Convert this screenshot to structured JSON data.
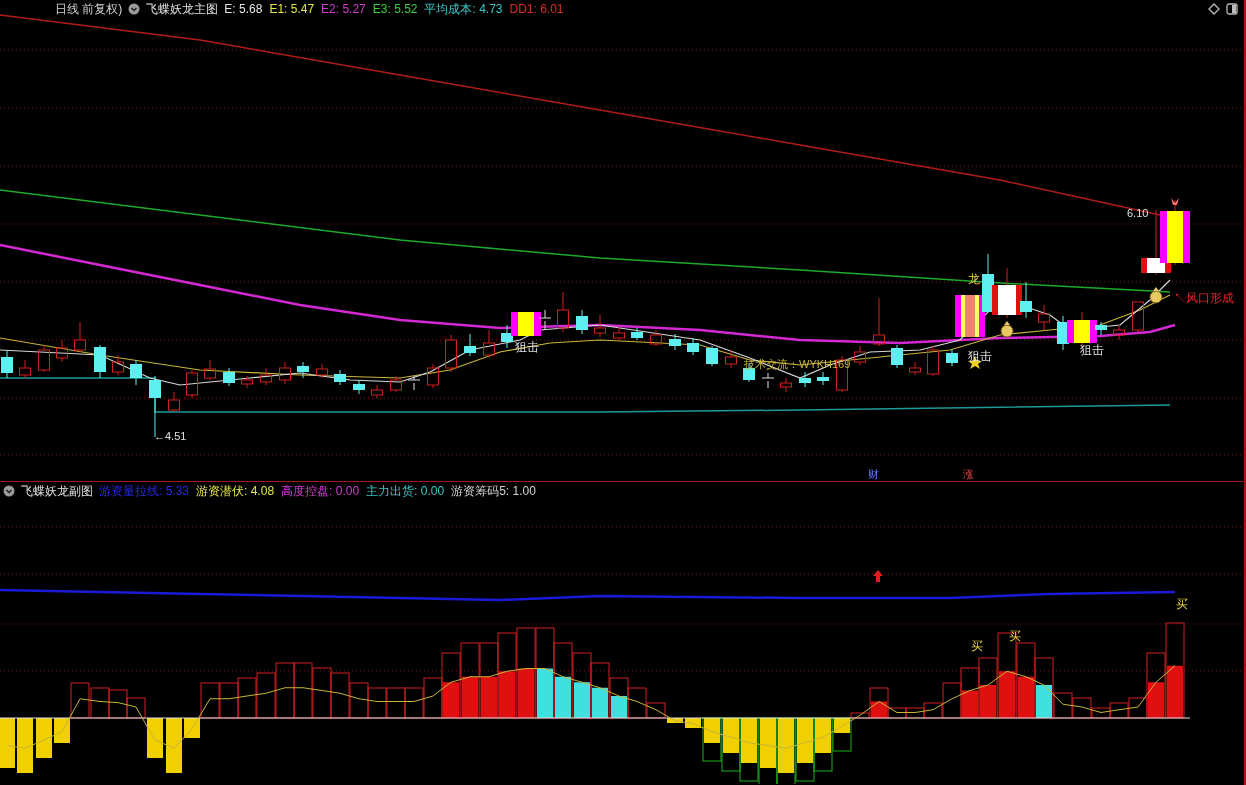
{
  "main_chart": {
    "period": "日线 前复权)",
    "indicator": "飞蝶妖龙主图",
    "legend": [
      {
        "text": "E: 5.68",
        "color": "#e6e6e6"
      },
      {
        "text": "E1: 5.47",
        "color": "#e6e64a"
      },
      {
        "text": "E2: 5.27",
        "color": "#d23cd2"
      },
      {
        "text": "E3: 5.52",
        "color": "#3cd23c"
      },
      {
        "text": "平均成本: 4.73",
        "color": "#3cc8c8"
      },
      {
        "text": "DD1: 6.01",
        "color": "#e02828"
      }
    ],
    "labels": [
      {
        "text": "6.10"
      },
      {
        "text": "↖风口形成"
      },
      {
        "text": "龙"
      },
      {
        "text": "狙击"
      },
      {
        "text": "狙击"
      },
      {
        "text": "狙击"
      },
      {
        "text": "技术交流：WYKH169"
      },
      {
        "text": "←4.51"
      },
      {
        "text": "财"
      },
      {
        "text": "涨"
      }
    ]
  },
  "sub_chart": {
    "indicator": "飞蝶妖龙副图",
    "legend": [
      {
        "text": "游资量拉线: 5.33",
        "color": "#2828e6"
      },
      {
        "text": "游资潜伏: 4.08",
        "color": "#e6e64a"
      },
      {
        "text": "高度控盘: 0.00",
        "color": "#d23cd2"
      },
      {
        "text": "主力出货: 0.00",
        "color": "#3cc8c8"
      },
      {
        "text": "游资筹码5: 1.00",
        "color": "#d0d0d0"
      }
    ],
    "labels": [
      {
        "text": "买"
      },
      {
        "text": "买"
      },
      {
        "text": "买"
      }
    ]
  }
}
